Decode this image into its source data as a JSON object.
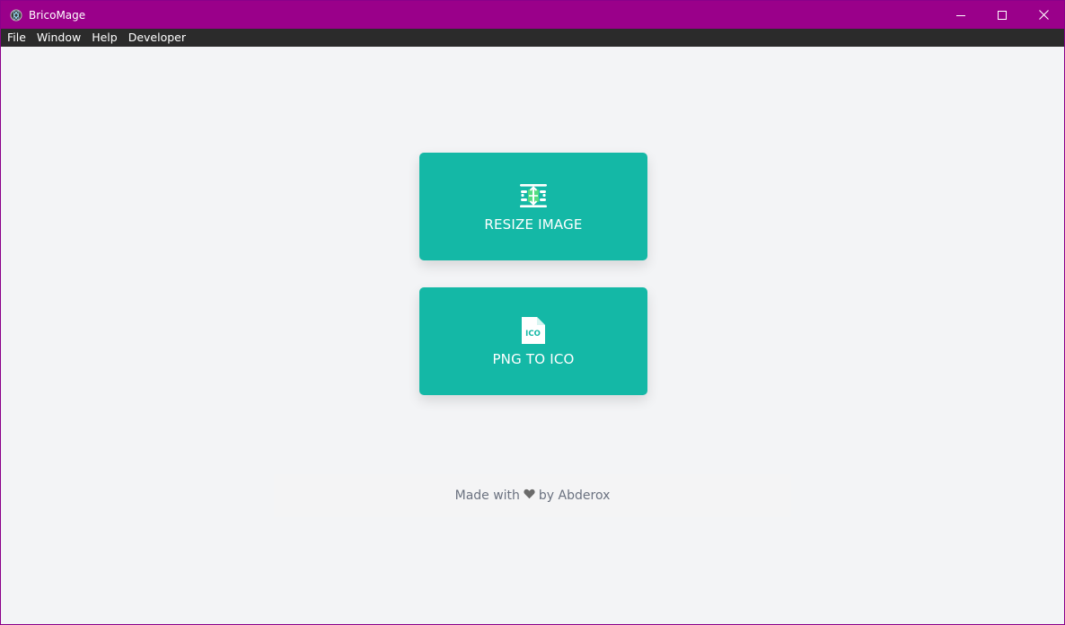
{
  "window": {
    "title": "BricoMage",
    "controls": {
      "minimize_icon": "minimize-icon",
      "maximize_icon": "maximize-icon",
      "close_icon": "close-icon"
    }
  },
  "menubar": {
    "items": [
      {
        "label": "File"
      },
      {
        "label": "Window"
      },
      {
        "label": "Help"
      },
      {
        "label": "Developer"
      }
    ]
  },
  "cards": [
    {
      "label": "RESIZE IMAGE",
      "icon": "resize-icon"
    },
    {
      "label": "PNG TO ICO",
      "icon": "ico-file-icon"
    }
  ],
  "footer": {
    "prefix": "Made with",
    "suffix": "by Abderox"
  },
  "colors": {
    "titlebar": "#9a008a",
    "menubar": "#2b2b2b",
    "card": "#14b8a6",
    "background": "#f3f4f6"
  }
}
